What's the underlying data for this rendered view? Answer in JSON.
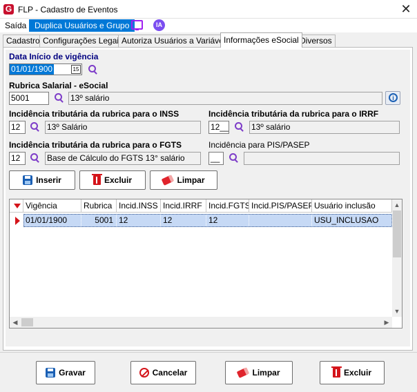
{
  "window": {
    "title": "FLP - Cadastro de Eventos",
    "logo": "G",
    "close": "✕"
  },
  "menu": {
    "saida": "Saída",
    "duplica": "Duplica Usuários e Grupo",
    "ia": "IA"
  },
  "tabs": [
    "Cadastro",
    "Configurações Legais",
    "Autoriza Usuários a Variáveis",
    "Informações eSocial",
    "Diversos"
  ],
  "form": {
    "data_inicio_label": "Data Início de vigência",
    "data_inicio_value": "01/01/1900",
    "calendar_glyph": "15",
    "rubrica_label": "Rubrica Salarial - eSocial",
    "rubrica_code": "5001",
    "rubrica_desc": "13º salário",
    "inss_label": "Incidência tributária da rubrica para o INSS",
    "inss_code": "12",
    "inss_desc": "13º Salário",
    "irrf_label": "Incidência tributária da rubrica para o IRRF",
    "irrf_code": "12__",
    "irrf_desc": "13º salário",
    "fgts_label": "Incidência tributária da rubrica para o FGTS",
    "fgts_code": "12",
    "fgts_desc": "Base de Cálculo do FGTS 13° salário",
    "pis_label": "Incidência para PIS/PASEP",
    "pis_code": "__",
    "pis_desc": ""
  },
  "actions": {
    "inserir": "Inserir",
    "excluir": "Excluir",
    "limpar": "Limpar"
  },
  "grid": {
    "headers": [
      "Vigência",
      "Rubrica",
      "Incid.INSS",
      "Incid.IRRF",
      "Incid.FGTS",
      "Incid.PIS/PASEP",
      "Usuário inclusão"
    ],
    "rows": [
      [
        "01/01/1900",
        "5001",
        "12",
        "12",
        "12",
        "",
        "USU_INCLUSAO"
      ]
    ]
  },
  "footer": {
    "gravar": "Gravar",
    "cancelar": "Cancelar",
    "limpar": "Limpar",
    "excluir": "Excluir"
  },
  "colors": {
    "accent": "#0078d7",
    "label_navy": "#000080",
    "danger": "#d4141a",
    "icon_purple": "#7d3cc8",
    "selection": "#c6d9f5"
  }
}
